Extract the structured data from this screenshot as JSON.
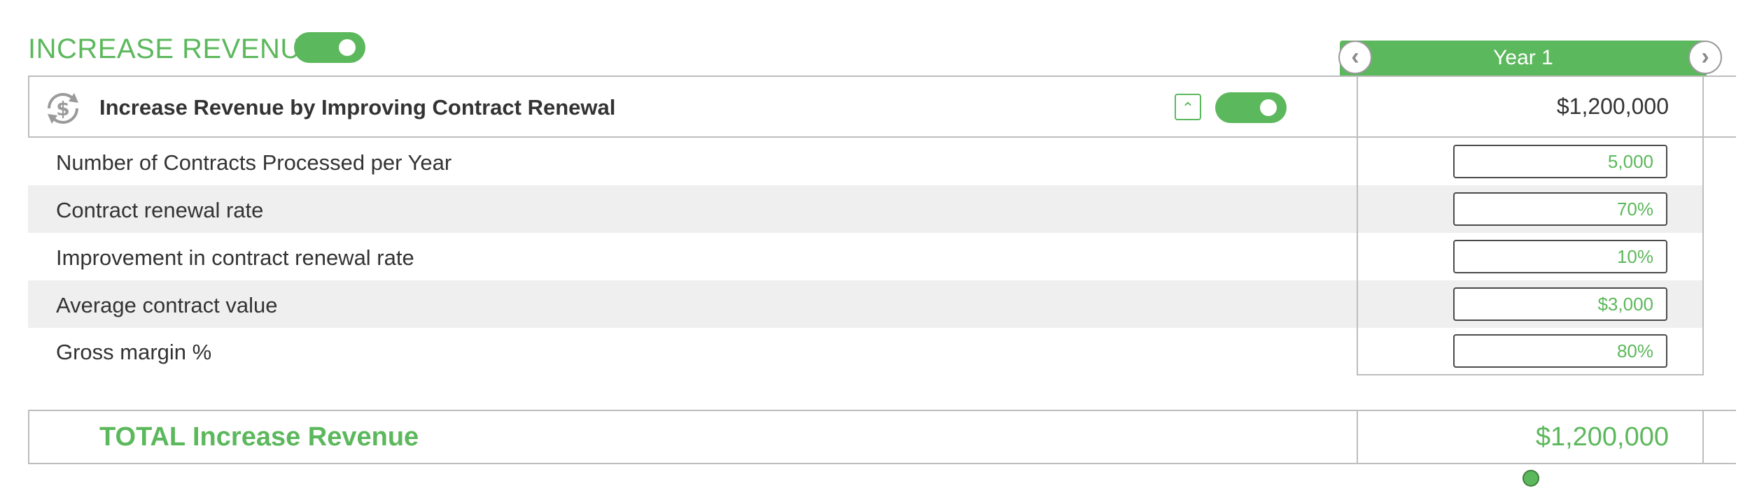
{
  "section": {
    "title": "INCREASE REVENUE",
    "enabled": true
  },
  "year_header": {
    "label": "Year 1",
    "prev_icon": "chevron-left-icon",
    "next_icon": "chevron-right-icon"
  },
  "item": {
    "icon": "dollar-cycle-icon",
    "title": "Increase Revenue by Improving Contract Renewal",
    "collapse_icon": "chevron-up-icon",
    "enabled": true,
    "value": "$1,200,000"
  },
  "rows": [
    {
      "label": "Number of Contracts Processed per Year",
      "value": "5,000"
    },
    {
      "label": "Contract renewal rate",
      "value": "70%"
    },
    {
      "label": "Improvement in contract renewal rate",
      "value": "10%"
    },
    {
      "label": "Average contract value",
      "value": "$3,000"
    },
    {
      "label": "Gross margin %",
      "value": "80%"
    }
  ],
  "total": {
    "label": "TOTAL Increase Revenue",
    "value": "$1,200,000"
  },
  "colors": {
    "accent": "#5cb85c",
    "row_shade": "#efefef",
    "border": "#bdbdbd"
  }
}
